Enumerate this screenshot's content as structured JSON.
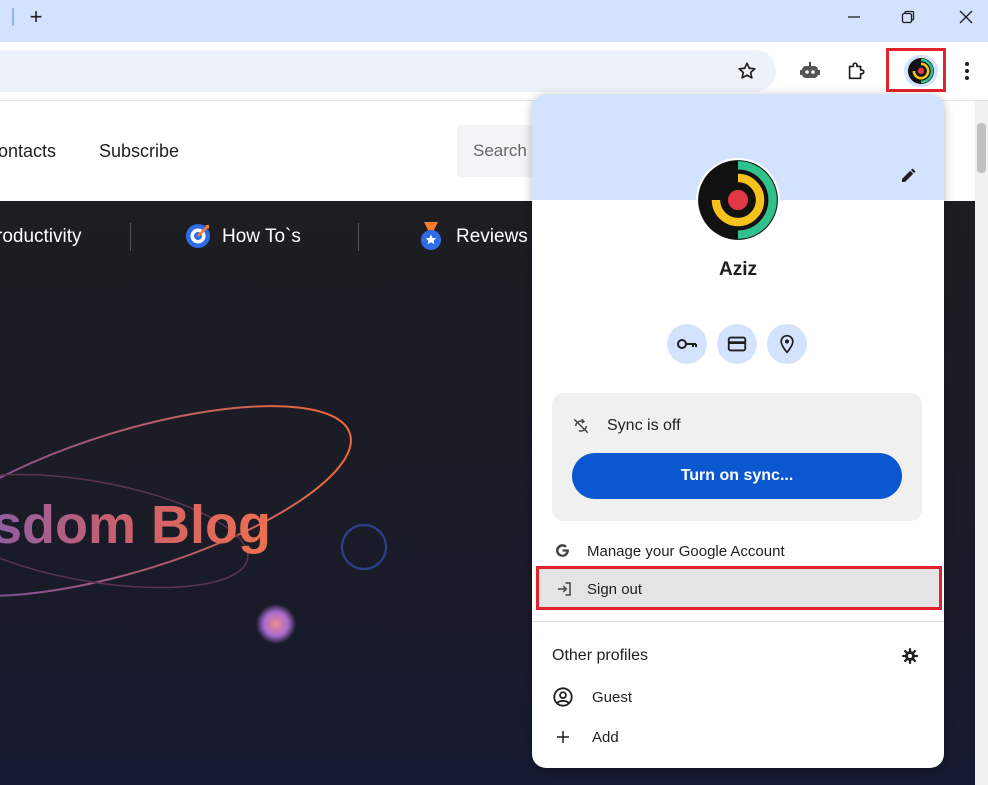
{
  "browser": {
    "new_tab_symbol": "+",
    "window_controls": [
      "minimize-icon",
      "restore-icon",
      "close-icon"
    ],
    "toolbar_icons": [
      "star-icon",
      "robot-icon",
      "extensions-icon",
      "profile-avatar",
      "more-vert-icon"
    ],
    "highlight_color": "#e3222c"
  },
  "site": {
    "nav": {
      "contacts": "ontacts",
      "subscribe": "Subscribe",
      "search_placeholder": "Search"
    },
    "categories": {
      "productivity": "roductivity",
      "howtos": "How To`s",
      "reviews": "Reviews"
    },
    "hero_title": "sdom Blog"
  },
  "profile_menu": {
    "name": "Aziz",
    "quick_icons": [
      "key-icon",
      "credit-card-icon",
      "location-pin-icon"
    ],
    "sync": {
      "status": "Sync is off",
      "button_label": "Turn on sync..."
    },
    "manage_account": "Manage your Google Account",
    "sign_out": "Sign out",
    "other_profiles_title": "Other profiles",
    "guest": "Guest",
    "add": "Add",
    "accent_color": "#0b57d0"
  }
}
